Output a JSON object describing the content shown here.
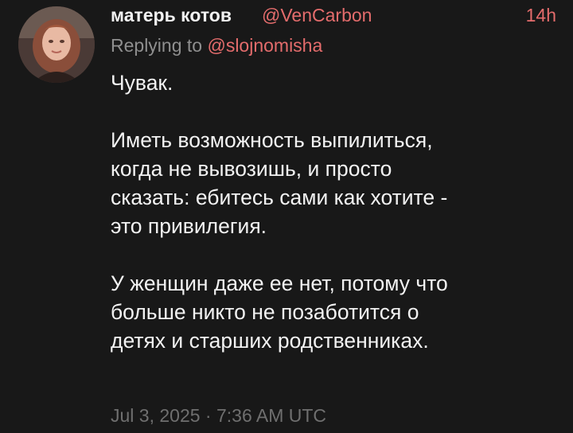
{
  "post": {
    "display_name": "матерь котов",
    "handle": "@VenCarbon",
    "time_ago": "14h",
    "reply_prefix": "Replying to ",
    "reply_to": "@slojnomisha",
    "paragraphs": [
      [
        "Чувак."
      ],
      [
        "Иметь возможность выпилиться,",
        "когда не вывозишь, и просто",
        "сказать: ебитесь сами как хотите -",
        "это привилегия."
      ],
      [
        "У женщин даже ее нет, потому что",
        "больше никто не позаботится о",
        "детях и старших родственниках."
      ]
    ],
    "date": "Jul 3, 2025",
    "separator": "·",
    "time": "7:36 AM UTC"
  },
  "colors": {
    "background": "#181818",
    "text": "#f2f2f2",
    "accent": "#e46c6c",
    "muted": "#8f8f8f",
    "timestamp": "#6f6f6f"
  }
}
